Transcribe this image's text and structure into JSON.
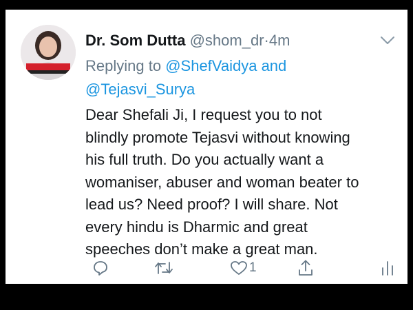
{
  "tweet": {
    "author_name": "Dr. Som Dutta",
    "author_handle": "@shom_dr",
    "separator": "·",
    "timestamp": "4m",
    "reply_prefix": "Replying to",
    "reply_mention_1": "@ShefVaidya",
    "reply_conjunction": "and",
    "reply_mention_2": "@Tejasvi_Surya",
    "body_lines": [
      "Dear Shefali Ji, I request you to not",
      "blindly promote Tejasvi without knowing",
      "his full truth. Do you actually want a",
      "womaniser,  abuser and woman beater to",
      "lead us? Need proof? I will share. Not",
      "every hindu is Dharmic and great",
      "speeches don’t make a great man."
    ],
    "like_count": "1"
  },
  "icons": {
    "reply": "reply-icon",
    "retweet": "retweet-icon",
    "like": "heart-icon",
    "share": "share-icon",
    "analytics": "analytics-icon",
    "menu": "chevron-down-icon"
  },
  "colors": {
    "text": "#14171a",
    "secondary": "#657786",
    "link": "#1b95e0",
    "frame": "#000000"
  }
}
